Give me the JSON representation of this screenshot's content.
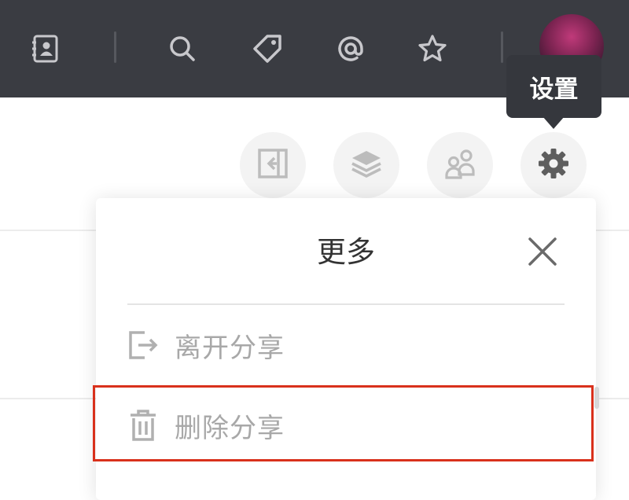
{
  "toolbar": {
    "icons": [
      "contacts-icon",
      "search-icon",
      "tag-icon",
      "mention-icon",
      "star-icon"
    ],
    "avatar": "user-avatar"
  },
  "tooltip": {
    "text": "设置"
  },
  "actions": {
    "icons": [
      "collapse-panel-icon",
      "layers-icon",
      "members-icon",
      "gear-icon"
    ]
  },
  "more_panel": {
    "title": "更多",
    "items": [
      {
        "label": "离开分享",
        "icon": "exit-icon"
      },
      {
        "label": "删除分享",
        "icon": "trash-icon"
      }
    ]
  },
  "colors": {
    "topbar": "#3a3c42",
    "highlight": "#d9311c",
    "muted_text": "#a8a8a8"
  }
}
